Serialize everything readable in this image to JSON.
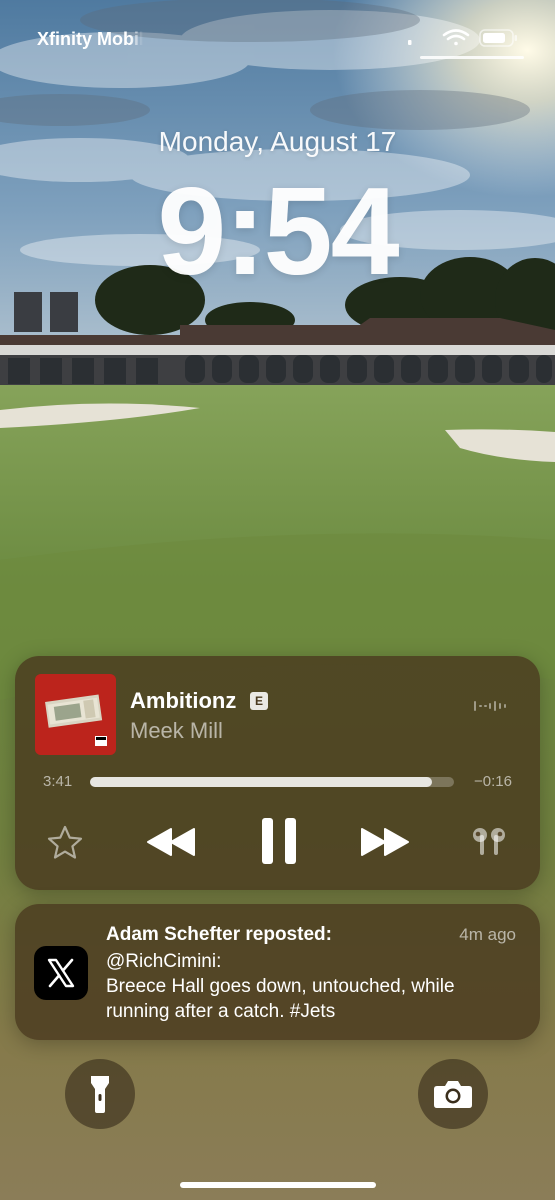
{
  "status_bar": {
    "carrier": "Xfinity Mobile",
    "icons": [
      "signal-icon",
      "wifi-icon",
      "battery-icon"
    ]
  },
  "lock_screen": {
    "date": "Monday, August 17",
    "time": "9:54"
  },
  "now_playing": {
    "title": "Ambitionz",
    "explicit_badge": "E",
    "artist": "Meek Mill",
    "elapsed": "3:41",
    "remaining": "−0:16",
    "progress": 0.94,
    "controls": [
      "star-icon",
      "rewind-icon",
      "pause-icon",
      "fast-forward-icon",
      "airpods-icon"
    ]
  },
  "notification": {
    "app_icon": "x-logo-icon",
    "title": "Adam Schefter reposted:",
    "time": "4m ago",
    "handle": "@RichCimini:",
    "message": "Breece Hall goes down, untouched, while running after a catch. #Jets"
  },
  "quick_actions": {
    "left": "flashlight-icon",
    "right": "camera-icon"
  },
  "colors": {
    "card_bg": "#48381e",
    "sky_top": "#5a86ab",
    "grass": "#6f8742",
    "album_red": "#c8281f"
  }
}
